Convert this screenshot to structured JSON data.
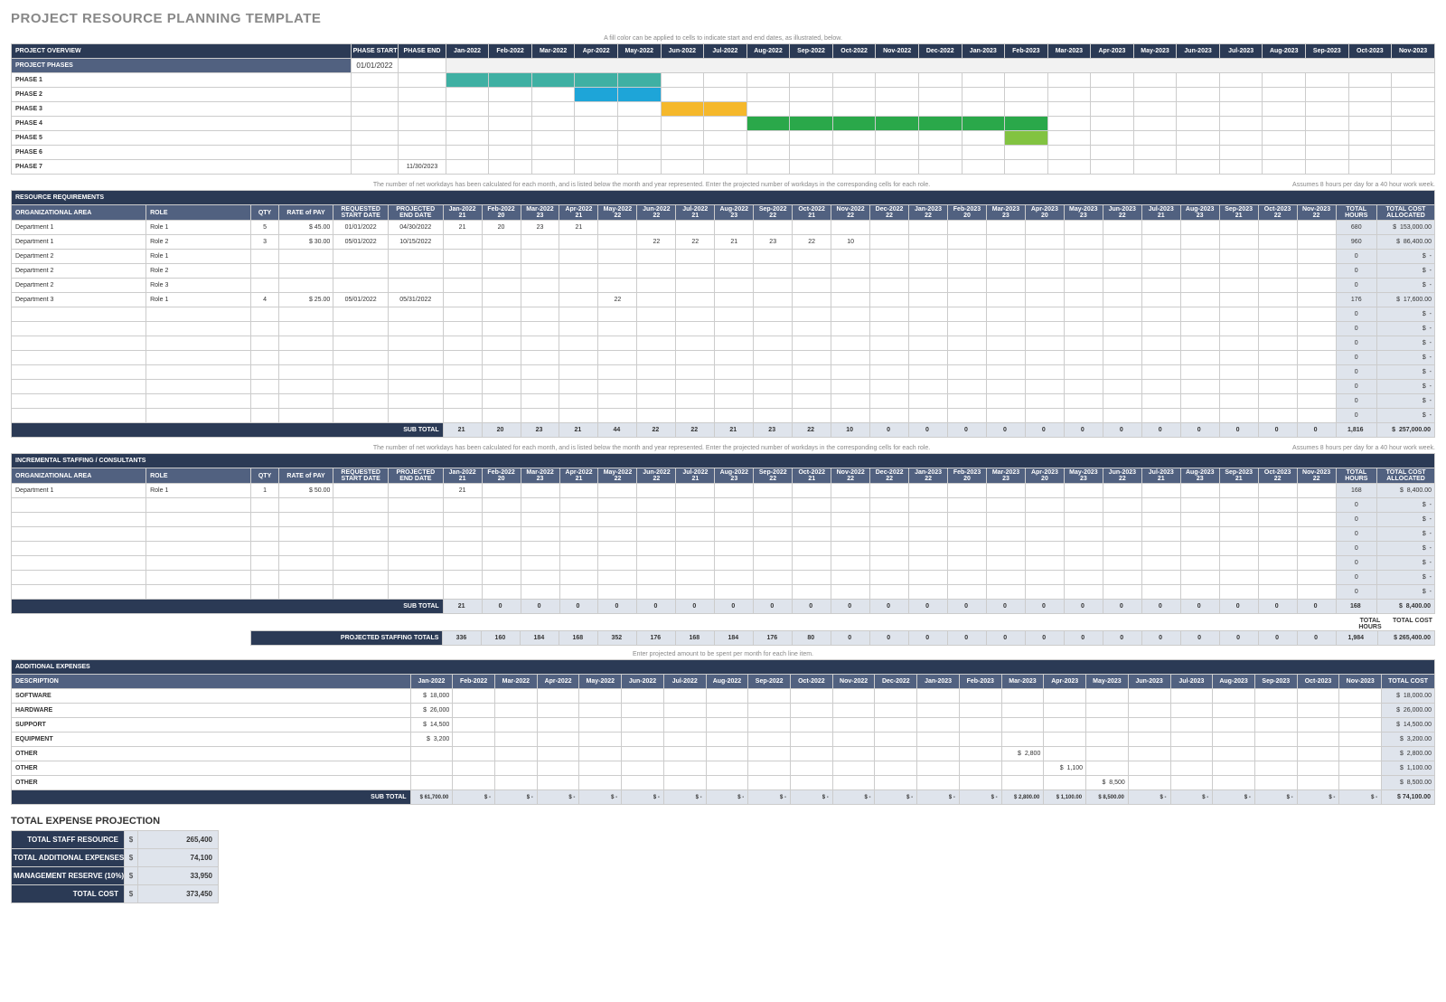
{
  "title": "PROJECT RESOURCE PLANNING TEMPLATE",
  "months": [
    "Jan-2022",
    "Feb-2022",
    "Mar-2022",
    "Apr-2022",
    "May-2022",
    "Jun-2022",
    "Jul-2022",
    "Aug-2022",
    "Sep-2022",
    "Oct-2022",
    "Nov-2022",
    "Dec-2022",
    "Jan-2023",
    "Feb-2023",
    "Mar-2023",
    "Apr-2023",
    "May-2023",
    "Jun-2023",
    "Jul-2023",
    "Aug-2023",
    "Sep-2023",
    "Oct-2023",
    "Nov-2023"
  ],
  "workdays": [
    "21",
    "20",
    "23",
    "21",
    "22",
    "22",
    "21",
    "23",
    "22",
    "21",
    "22",
    "22",
    "22",
    "20",
    "23",
    "20",
    "23",
    "22",
    "21",
    "23",
    "21",
    "22",
    "22"
  ],
  "overview": {
    "header": "PROJECT OVERVIEW",
    "note": "A fill color can be applied to cells to indicate start and end dates, as illustrated, below.",
    "col_start": "PHASE START",
    "col_end": "PHASE END",
    "phases_label": "PROJECT PHASES",
    "phases_start": "01/01/2022",
    "phases": [
      {
        "name": "PHASE 1",
        "bars": [
          [
            "g-teal",
            0,
            5
          ]
        ]
      },
      {
        "name": "PHASE 2",
        "bars": [
          [
            "g-cyan",
            3,
            5
          ],
          [
            "g-blue",
            3,
            3
          ]
        ]
      },
      {
        "name": "PHASE 3",
        "bars": [
          [
            "g-yellow",
            5,
            7
          ]
        ]
      },
      {
        "name": "PHASE 4",
        "bars": [
          [
            "g-green",
            7,
            14
          ]
        ]
      },
      {
        "name": "PHASE 5",
        "bars": [
          [
            "g-lime",
            13,
            14
          ]
        ]
      },
      {
        "name": "PHASE 6",
        "bars": []
      },
      {
        "name": "PHASE 7",
        "end": "11/30/2023",
        "bars": []
      }
    ]
  },
  "resources": {
    "header": "RESOURCE REQUIREMENTS",
    "note": "The number of net workdays has been calculated for each month, and is listed below the month and year represented. Enter the projected number of workdays in the corresponding cells for each role.",
    "note_right": "Assumes 8 hours per day for a 40 hour work week.",
    "cols": {
      "area": "ORGANIZATIONAL AREA",
      "role": "ROLE",
      "qty": "QTY",
      "rate": "RATE of PAY",
      "start": "REQUESTED START DATE",
      "end": "PROJECTED END DATE",
      "hours": "TOTAL HOURS",
      "cost": "TOTAL COST ALLOCATED"
    },
    "rows": [
      {
        "area": "Department 1",
        "role": "Role 1",
        "qty": "5",
        "rate": "45.00",
        "start": "01/01/2022",
        "end": "04/30/2022",
        "days": [
          "21",
          "20",
          "23",
          "21",
          "",
          "",
          "",
          "",
          "",
          "",
          "",
          "",
          "",
          "",
          "",
          "",
          "",
          "",
          "",
          "",
          "",
          "",
          ""
        ],
        "hours": "680",
        "cost": "153,000.00"
      },
      {
        "area": "Department 1",
        "role": "Role 2",
        "qty": "3",
        "rate": "30.00",
        "start": "05/01/2022",
        "end": "10/15/2022",
        "days": [
          "",
          "",
          "",
          "",
          "",
          "22",
          "22",
          "21",
          "23",
          "22",
          "10",
          "",
          "",
          "",
          "",
          "",
          "",
          "",
          "",
          "",
          "",
          "",
          ""
        ],
        "hours": "960",
        "cost": "86,400.00"
      },
      {
        "area": "Department 2",
        "role": "Role 1",
        "qty": "",
        "rate": "",
        "start": "",
        "end": "",
        "days": [
          "",
          "",
          "",
          "",
          "",
          "",
          "",
          "",
          "",
          "",
          "",
          "",
          "",
          "",
          "",
          "",
          "",
          "",
          "",
          "",
          "",
          "",
          ""
        ],
        "hours": "0",
        "cost": "-"
      },
      {
        "area": "Department 2",
        "role": "Role 2",
        "qty": "",
        "rate": "",
        "start": "",
        "end": "",
        "days": [
          "",
          "",
          "",
          "",
          "",
          "",
          "",
          "",
          "",
          "",
          "",
          "",
          "",
          "",
          "",
          "",
          "",
          "",
          "",
          "",
          "",
          "",
          ""
        ],
        "hours": "0",
        "cost": "-"
      },
      {
        "area": "Department 2",
        "role": "Role 3",
        "qty": "",
        "rate": "",
        "start": "",
        "end": "",
        "days": [
          "",
          "",
          "",
          "",
          "",
          "",
          "",
          "",
          "",
          "",
          "",
          "",
          "",
          "",
          "",
          "",
          "",
          "",
          "",
          "",
          "",
          "",
          ""
        ],
        "hours": "0",
        "cost": "-"
      },
      {
        "area": "Department 3",
        "role": "Role 1",
        "qty": "4",
        "rate": "25.00",
        "start": "05/01/2022",
        "end": "05/31/2022",
        "days": [
          "",
          "",
          "",
          "",
          "22",
          "",
          "",
          "",
          "",
          "",
          "",
          "",
          "",
          "",
          "",
          "",
          "",
          "",
          "",
          "",
          "",
          "",
          ""
        ],
        "hours": "176",
        "cost": "17,600.00"
      }
    ],
    "blank_rows": 8,
    "subtotal_label": "SUB TOTAL",
    "subtotal": [
      "21",
      "20",
      "23",
      "21",
      "44",
      "22",
      "22",
      "21",
      "23",
      "22",
      "10",
      "0",
      "0",
      "0",
      "0",
      "0",
      "0",
      "0",
      "0",
      "0",
      "0",
      "0",
      "0"
    ],
    "sub_hours": "1,816",
    "sub_cost": "257,000.00"
  },
  "incremental": {
    "header": "INCREMENTAL STAFFING / CONSULTANTS",
    "rows": [
      {
        "area": "Department 1",
        "role": "Role 1",
        "qty": "1",
        "rate": "50.00",
        "start": "",
        "end": "",
        "days": [
          "21",
          "",
          "",
          "",
          "",
          "",
          "",
          "",
          "",
          "",
          "",
          "",
          "",
          "",
          "",
          "",
          "",
          "",
          "",
          "",
          "",
          "",
          ""
        ],
        "hours": "168",
        "cost": "8,400.00"
      }
    ],
    "blank_rows": 7,
    "subtotal_label": "SUB TOTAL",
    "subtotal": [
      "21",
      "0",
      "0",
      "0",
      "0",
      "0",
      "0",
      "0",
      "0",
      "0",
      "0",
      "0",
      "0",
      "0",
      "0",
      "0",
      "0",
      "0",
      "0",
      "0",
      "0",
      "0",
      "0"
    ],
    "sub_hours": "168",
    "sub_cost": "8,400.00"
  },
  "proj_totals": {
    "label": "PROJECTED STAFFING TOTALS",
    "label_hours": "TOTAL HOURS",
    "label_cost": "TOTAL COST",
    "vals": [
      "336",
      "160",
      "184",
      "168",
      "352",
      "176",
      "168",
      "184",
      "176",
      "80",
      "0",
      "0",
      "0",
      "0",
      "0",
      "0",
      "0",
      "0",
      "0",
      "0",
      "0",
      "0",
      "0"
    ],
    "hours": "1,984",
    "cost": "265,400.00"
  },
  "expenses": {
    "header": "ADDITIONAL EXPENSES",
    "note": "Enter projected amount to be spent per month for each line item.",
    "col_desc": "DESCRIPTION",
    "col_total": "TOTAL COST",
    "rows": [
      {
        "desc": "SOFTWARE",
        "vals": [
          "18,000",
          "",
          "",
          "",
          "",
          "",
          "",
          "",
          "",
          "",
          "",
          "",
          "",
          "",
          "",
          "",
          "",
          "",
          "",
          "",
          "",
          "",
          ""
        ],
        "total": "18,000.00"
      },
      {
        "desc": "HARDWARE",
        "vals": [
          "26,000",
          "",
          "",
          "",
          "",
          "",
          "",
          "",
          "",
          "",
          "",
          "",
          "",
          "",
          "",
          "",
          "",
          "",
          "",
          "",
          "",
          "",
          ""
        ],
        "total": "26,000.00"
      },
      {
        "desc": "SUPPORT",
        "vals": [
          "14,500",
          "",
          "",
          "",
          "",
          "",
          "",
          "",
          "",
          "",
          "",
          "",
          "",
          "",
          "",
          "",
          "",
          "",
          "",
          "",
          "",
          "",
          ""
        ],
        "total": "14,500.00"
      },
      {
        "desc": "EQUIPMENT",
        "vals": [
          "3,200",
          "",
          "",
          "",
          "",
          "",
          "",
          "",
          "",
          "",
          "",
          "",
          "",
          "",
          "",
          "",
          "",
          "",
          "",
          "",
          "",
          "",
          ""
        ],
        "total": "3,200.00"
      },
      {
        "desc": "OTHER",
        "vals": [
          "",
          "",
          "",
          "",
          "",
          "",
          "",
          "",
          "",
          "",
          "",
          "",
          "",
          "",
          "2,800",
          "",
          "",
          "",
          "",
          "",
          "",
          "",
          ""
        ],
        "total": "2,800.00"
      },
      {
        "desc": "OTHER",
        "vals": [
          "",
          "",
          "",
          "",
          "",
          "",
          "",
          "",
          "",
          "",
          "",
          "",
          "",
          "",
          "",
          "1,100",
          "",
          "",
          "",
          "",
          "",
          "",
          ""
        ],
        "total": "1,100.00"
      },
      {
        "desc": "OTHER",
        "vals": [
          "",
          "",
          "",
          "",
          "",
          "",
          "",
          "",
          "",
          "",
          "",
          "",
          "",
          "",
          "",
          "",
          "8,500",
          "",
          "",
          "",
          "",
          "",
          ""
        ],
        "total": "8,500.00"
      }
    ],
    "subtotal_label": "SUB TOTAL",
    "subtotal": [
      "61,700.00",
      "-",
      "-",
      "-",
      "-",
      "-",
      "-",
      "-",
      "-",
      "-",
      "-",
      "-",
      "-",
      "-",
      "2,800.00",
      "1,100.00",
      "8,500.00",
      "-",
      "-",
      "-",
      "-",
      "-",
      "-"
    ],
    "sub_total": "74,100.00"
  },
  "summary": {
    "header": "TOTAL EXPENSE PROJECTION",
    "rows": [
      {
        "label": "TOTAL STAFF RESOURCE",
        "val": "265,400"
      },
      {
        "label": "TOTAL ADDITIONAL EXPENSES",
        "val": "74,100"
      },
      {
        "label": "MANAGEMENT RESERVE (10%)",
        "val": "33,950"
      },
      {
        "label": "TOTAL COST",
        "val": "373,450"
      }
    ]
  },
  "chart_data": {
    "type": "gantt-table",
    "columns": [
      "Jan-2022",
      "Feb-2022",
      "Mar-2022",
      "Apr-2022",
      "May-2022",
      "Jun-2022",
      "Jul-2022",
      "Aug-2022",
      "Sep-2022",
      "Oct-2022",
      "Nov-2022",
      "Dec-2022",
      "Jan-2023",
      "Feb-2023",
      "Mar-2023",
      "Apr-2023",
      "May-2023",
      "Jun-2023",
      "Jul-2023",
      "Aug-2023",
      "Sep-2023",
      "Oct-2023",
      "Nov-2023"
    ],
    "phases": [
      {
        "name": "PHASE 1",
        "start_idx": 0,
        "end_idx": 4,
        "color": "#3fb0a3"
      },
      {
        "name": "PHASE 2",
        "start_idx": 3,
        "end_idx": 4,
        "color": "#1ea5d8",
        "overlay": {
          "start_idx": 3,
          "end_idx": 2,
          "color": "#1665b5"
        }
      },
      {
        "name": "PHASE 3",
        "start_idx": 5,
        "end_idx": 6,
        "color": "#f5b82b"
      },
      {
        "name": "PHASE 4",
        "start_idx": 7,
        "end_idx": 13,
        "color": "#2aa84a"
      },
      {
        "name": "PHASE 5",
        "start_idx": 13,
        "end_idx": 13,
        "color": "#82c341"
      },
      {
        "name": "PHASE 6"
      },
      {
        "name": "PHASE 7",
        "end": "11/30/2023"
      }
    ]
  }
}
